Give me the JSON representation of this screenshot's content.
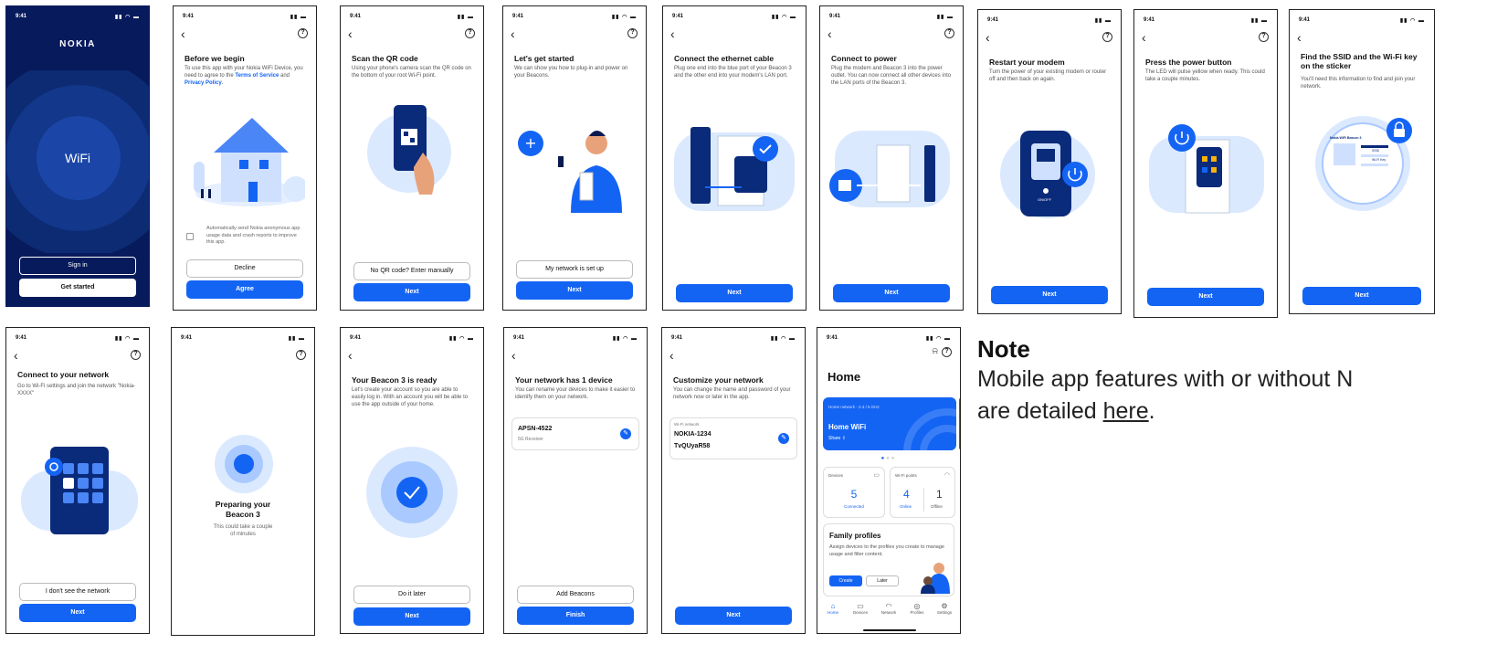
{
  "status_time": "9:41",
  "s1": {
    "brand": "NOKIA",
    "center": "WiFi",
    "signin": "Sign in",
    "get_started": "Get started"
  },
  "s2": {
    "title": "Before we begin",
    "desc_a": "To use this app with your Nokia WiFi Device, you need to agree to the ",
    "terms": "Terms of Service",
    "and": " and ",
    "privacy": "Privacy Policy",
    "dot": ".",
    "checkbox": "Automatically send Nokia anonymous app usage data and crash reports to improve this app.",
    "decline": "Decline",
    "agree": "Agree"
  },
  "s3": {
    "title": "Scan the QR code",
    "desc": "Using your phone's camera scan the QR code on the bottom of your root Wi-Fi point.",
    "manual": "No QR code? Enter manually",
    "next": "Next"
  },
  "s4": {
    "title": "Let's get started",
    "desc": "We can show you how to plug-in and power on your Beacons.",
    "set_up": "My network is set up",
    "next": "Next"
  },
  "s5": {
    "title": "Connect the ethernet cable",
    "desc": "Plug one end into the blue port of your Beacon 3 and the other end into your modem's LAN port.",
    "next": "Next"
  },
  "s6": {
    "title": "Connect to power",
    "desc": "Plug the modem and Beacon 3 into the power outlet. You can now connect all other devices into the LAN ports of the Beacon 3.",
    "next": "Next"
  },
  "s7": {
    "title": "Restart your modem",
    "desc": "Turn the power of your existing modem or router off and then back on again.",
    "onoff": "ON/OFF",
    "next": "Next"
  },
  "s8": {
    "title": "Press the power button",
    "desc": "The LED will pulse yellow when ready. This could take a couple minutes.",
    "next": "Next"
  },
  "s9": {
    "title": "Find the SSID and the Wi-Fi key on the sticker",
    "desc": "You'll need this information to find and join your network.",
    "sticker": "Nokia WiFi Beacon 3",
    "ssid": "SSID",
    "wifikey": "Wi-Fi Key",
    "next": "Next"
  },
  "s10": {
    "title": "Connect to your network",
    "desc": "Go to Wi-Fi settings and join the network \"Nokia-XXXX\"",
    "nosee": "I don't see the network",
    "next": "Next"
  },
  "s11": {
    "title": "Preparing your Beacon 3",
    "desc": "This could take a couple of minutes"
  },
  "s12": {
    "title": "Your Beacon 3 is ready",
    "desc": "Let's create your account so you are able to easily log in. With an account you will be able to use the app outside of your home.",
    "later": "Do it later",
    "next": "Next"
  },
  "s13": {
    "title": "Your network has 1 device",
    "desc": "You can rename your devices to make it easier to identify them on your network.",
    "device": "APSN-4522",
    "device_sub": "5G Receiver",
    "add": "Add Beacons",
    "finish": "Finish"
  },
  "s14": {
    "title": "Customize your network",
    "desc": "You can change the name and password of your network now or later in the app.",
    "label": "Wi-Fi network",
    "name": "NOKIA-1234",
    "pass": "TvQUyaR58",
    "next": "Next"
  },
  "s15": {
    "title": "Home",
    "card_sub": "Home network - 2.4 / 5 GHz",
    "card_title": "Home WiFi",
    "share": "Share",
    "devices_label": "Devices",
    "devices_num": "5",
    "devices_status": "Connected",
    "wifi_label": "Wi-Fi points",
    "online_num": "4",
    "online_label": "Online",
    "offline_num": "1",
    "offline_label": "Offline",
    "fam_title": "Family profiles",
    "fam_desc": "Assign devices to the profiles you create to manage usage and filter content.",
    "create": "Create",
    "later": "Later",
    "nav": [
      "Home",
      "Devices",
      "Network",
      "Profiles",
      "Settings"
    ]
  },
  "note": {
    "title": "Note",
    "line1": "Mobile app features with or without N",
    "line2_a": "are detailed ",
    "link": "here",
    "line2_b": "."
  },
  "colors": {
    "primary": "#1464f4",
    "navy": "#0a1a4f",
    "light_blue": "#dbe9ff",
    "mid_blue": "#a9c9ff"
  }
}
